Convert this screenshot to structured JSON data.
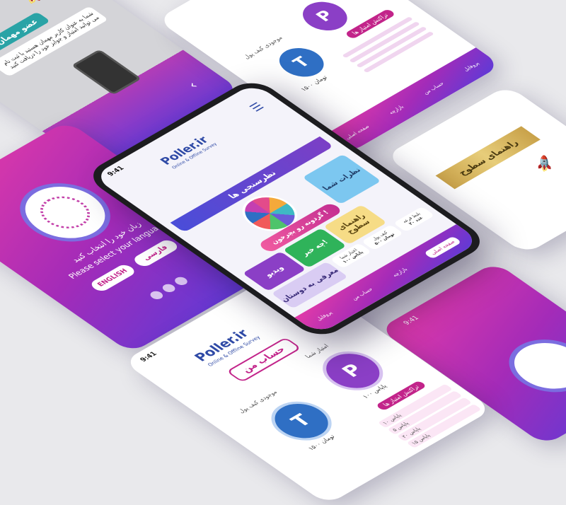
{
  "center_phone": {
    "status_time": "9:41",
    "brand": "Poller.ir",
    "brand_tagline": "Online & Offline Survey",
    "banner_title": "نظرسنجی ها",
    "wheel_button": "گردونه رو بچرخون !",
    "tiles": {
      "your_polls": "نظرات شما",
      "levels_guide": "راهنمای سطوح",
      "video": "ویدیو",
      "news": "چه خبر!",
      "invite": "معرفی به دوستان"
    },
    "stats": [
      "۱۰۰ پاپاس",
      "۵۰۰ تومان",
      "۲۰ عدد"
    ],
    "stat_labels": [
      "اعتبار شما",
      "کیف پول",
      "بلیط قرعه"
    ],
    "nav": [
      "صفحه اصلی",
      "بازارچه",
      "حساب من",
      "پروفایل"
    ]
  },
  "lang_phone": {
    "prompt_fa": "زبان خود را انتخاب کنید",
    "prompt_en": "Please select your language",
    "btn_fa": "فارسی",
    "btn_en": "ENGLISH"
  },
  "guest_phone": {
    "badge": "عضو مهمان",
    "text": "شما به عنوان کاربر مهمان هستید با ثبت نام می توانید امتیاز و جوایز خود را دریافت کنید"
  },
  "account_phone": {
    "status_time": "9:41",
    "brand": "Poller.ir",
    "brand_tagline": "Online & Offline Survey",
    "title": "حساب من",
    "your_credit": "امتیاز شما",
    "wallet": "موجودی کیف پول",
    "coin_p": "P",
    "coin_t": "T",
    "credit_value": "۱۰۰ پاپاس",
    "wallet_value": "۱۵۰۰ تومان",
    "history": "تراکنش امتیاز ها",
    "rows": [
      "۱۰ پاپاس",
      "۵ پاپاس",
      "۲۰ پاپاس",
      "۱۵ پاپاس"
    ]
  },
  "top_account": {
    "coin_p": "P",
    "coin_t": "T",
    "wallet": "موجودی کیف پول",
    "wallet_value": "۱۵۰۰ تومان",
    "history": "تراکنش امتیاز ها",
    "nav": [
      "صفحه اصلی",
      "بازارچه",
      "حساب من",
      "پروفایل"
    ]
  },
  "levels_phone": {
    "title": "راهنمای سطوح"
  },
  "splash_phone": {
    "status_time": "9:41"
  }
}
